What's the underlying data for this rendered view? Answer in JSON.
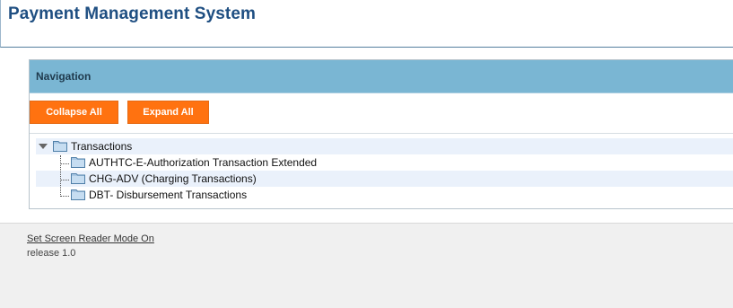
{
  "header": {
    "title": "Payment Management System"
  },
  "navigation": {
    "title": "Navigation",
    "collapse_all_label": "Collapse All",
    "expand_all_label": "Expand All",
    "tree": {
      "root": {
        "label": "Transactions",
        "expanded": true,
        "icon": "folder-icon"
      },
      "children": [
        {
          "label": "AUTHTC-E-Authorization Transaction Extended",
          "icon": "folder-icon"
        },
        {
          "label": "CHG-ADV (Charging Transactions)",
          "icon": "folder-icon"
        },
        {
          "label": "DBT- Disbursement Transactions",
          "icon": "folder-icon"
        }
      ]
    }
  },
  "footer": {
    "screen_reader_link": "Set Screen Reader Mode On",
    "release": "release 1.0"
  },
  "colors": {
    "title_blue": "#1f4f82",
    "nav_header_bg": "#7ab6d3",
    "button_orange": "#ff7210",
    "row_highlight": "#eaf1fb",
    "footer_bg": "#f0f0f0"
  }
}
